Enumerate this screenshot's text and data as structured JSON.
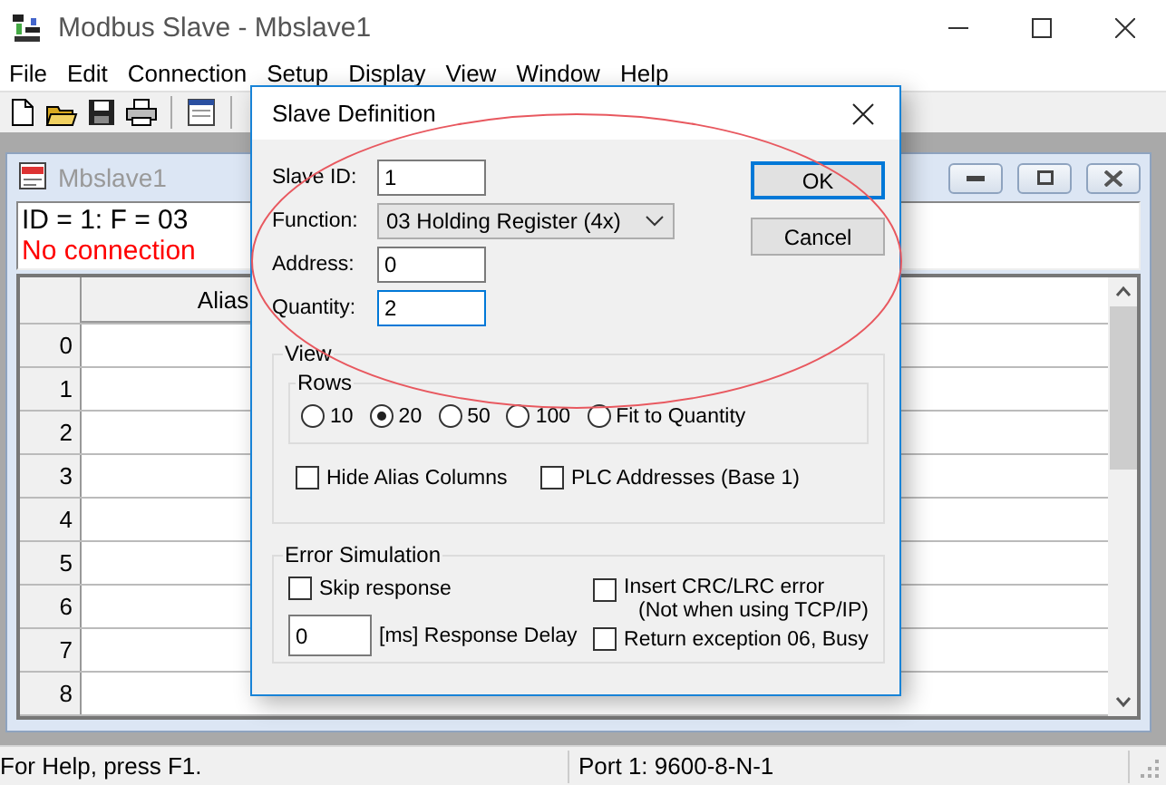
{
  "window": {
    "title": "Modbus Slave - Mbslave1"
  },
  "menu": [
    "File",
    "Edit",
    "Connection",
    "Setup",
    "Display",
    "View",
    "Window",
    "Help"
  ],
  "child_window": {
    "title": "Mbslave1",
    "info": "ID = 1: F = 03",
    "status": "No connection",
    "columns": [
      "Alias"
    ],
    "row_numbers": [
      "0",
      "1",
      "2",
      "3",
      "4",
      "5",
      "6",
      "7",
      "8"
    ]
  },
  "dialog": {
    "title": "Slave Definition",
    "fields": [
      {
        "label": "Slave ID:",
        "value": "1",
        "kind": "input",
        "focused": false
      },
      {
        "label": "Function:",
        "value": "03 Holding Register (4x)",
        "kind": "select",
        "focused": false
      },
      {
        "label": "Address:",
        "value": "0",
        "kind": "input",
        "focused": false
      },
      {
        "label": "Quantity:",
        "value": "2",
        "kind": "input",
        "focused": true
      }
    ],
    "buttons": [
      {
        "label": "OK",
        "default": true
      },
      {
        "label": "Cancel",
        "default": false
      }
    ],
    "view": {
      "title": "View",
      "rows_title": "Rows",
      "rows_options": [
        {
          "label": "10",
          "selected": false
        },
        {
          "label": "20",
          "selected": true
        },
        {
          "label": "50",
          "selected": false
        },
        {
          "label": "100",
          "selected": false
        },
        {
          "label": "Fit to Quantity",
          "selected": false
        }
      ],
      "checkboxes": [
        {
          "label": "Hide Alias Columns",
          "checked": false
        },
        {
          "label": "PLC Addresses (Base 1)",
          "checked": false
        }
      ]
    },
    "error_simulation": {
      "title": "Error Simulation",
      "skip_response": {
        "label": "Skip response",
        "checked": false
      },
      "response_delay": {
        "value": "0",
        "label": "[ms] Response Delay"
      },
      "insert_crc_error": {
        "label": "Insert CRC/LRC error",
        "note": "(Not when using TCP/IP)",
        "checked": false
      },
      "return_exception": {
        "label": "Return exception 06, Busy",
        "checked": false
      }
    }
  },
  "annotations": [
    {
      "kind": "ellipse"
    }
  ],
  "status_bar": [
    "For Help, press F1.",
    "Port 1: 9600-8-N-1"
  ]
}
